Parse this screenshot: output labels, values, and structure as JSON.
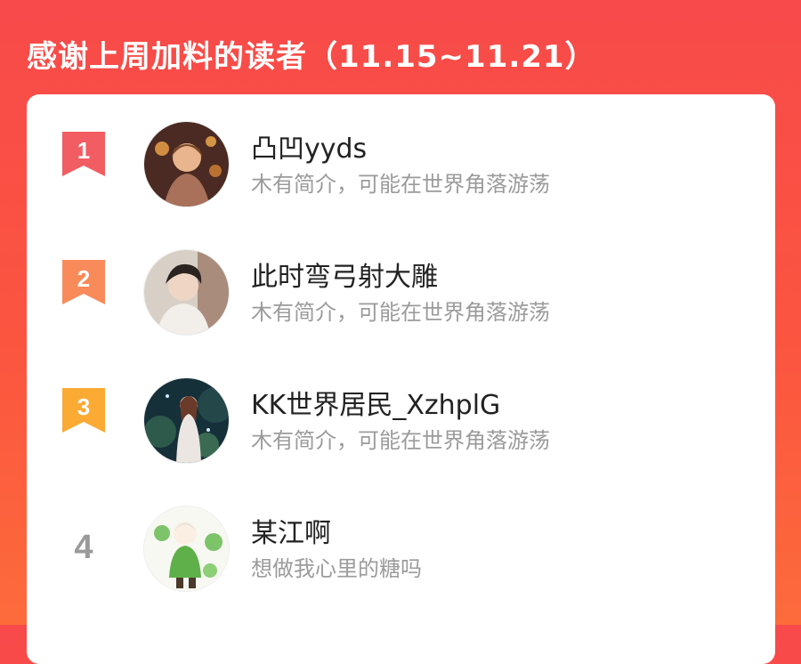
{
  "header": {
    "title": "感谢上周加料的读者（11.15~11.21）"
  },
  "colors": {
    "background_top": "#f84a4a",
    "background_bottom": "#fd6b3b",
    "rank1": "#f25c63",
    "rank2": "#f98a5a",
    "rank3": "#fbaa33",
    "rank_plain": "#9a9a9a"
  },
  "readers": [
    {
      "rank": "1",
      "name": "凸凹yyds",
      "bio": "木有简介，可能在世界角落游荡",
      "avatar_icon": "avatar-lantern-boy"
    },
    {
      "rank": "2",
      "name": "此时弯弓射大雕",
      "bio": "木有简介，可能在世界角落游荡",
      "avatar_icon": "avatar-portrait-boy"
    },
    {
      "rank": "3",
      "name": "KK世界居民_XzhplG",
      "bio": "木有简介，可能在世界角落游荡",
      "avatar_icon": "avatar-forest-girl"
    },
    {
      "rank": "4",
      "name": "某江啊",
      "bio": "想做我心里的糖吗",
      "avatar_icon": "avatar-clover-character"
    }
  ]
}
